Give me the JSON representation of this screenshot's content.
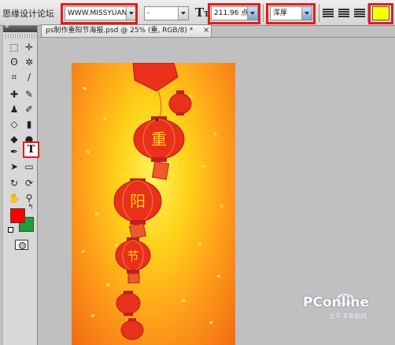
{
  "watermark_top": "思缘设计论坛",
  "options_bar": {
    "font_family_value": "WWW.MISSYUAN.COM",
    "font_style_value": "-",
    "font_size_value": "211.96 点",
    "antialias_value": "浑厚",
    "text_color": "#ffff00"
  },
  "document": {
    "tab_title": "ps制作重阳节海报.psd @ 25% (重, RGB/8) *",
    "close_glyph": "×"
  },
  "tools": {
    "foreground_color": "#ff0000",
    "background_color": "#1f9e3c",
    "selected_tool_glyph": "T"
  },
  "lanterns": {
    "char_1": "重",
    "char_2": "阳",
    "char_3": "节"
  },
  "watermark": {
    "brand": "PConline",
    "subtitle": "太平洋电脑网"
  },
  "colors": {
    "highlight_outline": "#e41b1b",
    "lantern_red": "#e8301a"
  }
}
